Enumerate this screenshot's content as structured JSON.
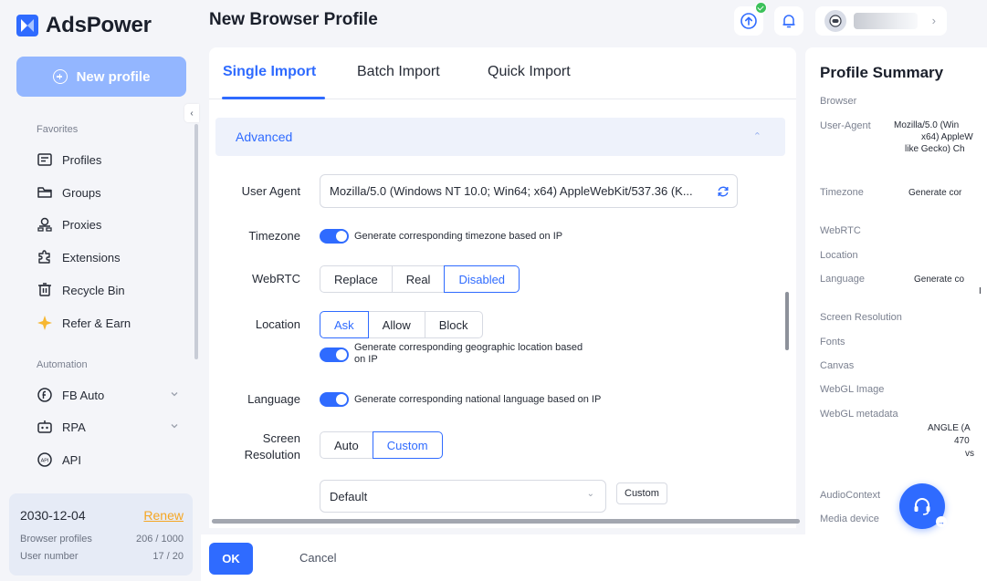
{
  "brand": {
    "name": "AdsPower",
    "accent": "#2f6bff"
  },
  "sidebar": {
    "new_profile_label": "New profile",
    "favorites_label": "Favorites",
    "items": [
      {
        "label": "Profiles",
        "icon": "profiles-icon"
      },
      {
        "label": "Groups",
        "icon": "folder-icon"
      },
      {
        "label": "Proxies",
        "icon": "proxies-icon"
      },
      {
        "label": "Extensions",
        "icon": "puzzle-icon"
      },
      {
        "label": "Recycle Bin",
        "icon": "trash-icon"
      },
      {
        "label": "Refer & Earn",
        "icon": "star-icon"
      }
    ],
    "automation_label": "Automation",
    "automation_items": [
      {
        "label": "FB Auto",
        "icon": "fb-auto-icon"
      },
      {
        "label": "RPA",
        "icon": "robot-icon"
      },
      {
        "label": "API",
        "icon": "api-icon"
      }
    ]
  },
  "account": {
    "expiry": "2030-12-04",
    "renew_label": "Renew",
    "profiles_label": "Browser profiles",
    "profiles_value": "206 / 1000",
    "users_label": "User number",
    "users_value": "17 / 20"
  },
  "header": {
    "title": "New Browser Profile"
  },
  "tabs": [
    {
      "label": "Single Import",
      "active": true
    },
    {
      "label": "Batch Import",
      "active": false
    },
    {
      "label": "Quick Import",
      "active": false
    }
  ],
  "advanced": {
    "title": "Advanced",
    "user_agent_label": "User Agent",
    "user_agent_value": "Mozilla/5.0 (Windows NT 10.0; Win64; x64) AppleWebKit/537.36 (K...",
    "timezone_label": "Timezone",
    "timezone_toggle_text": "Generate corresponding timezone based on IP",
    "webrtc_label": "WebRTC",
    "webrtc_options": [
      "Replace",
      "Real",
      "Disabled"
    ],
    "webrtc_selected": "Disabled",
    "location_label": "Location",
    "location_options": [
      "Ask",
      "Allow",
      "Block"
    ],
    "location_selected": "Ask",
    "location_toggle_line1": "Generate corresponding geographic location based",
    "location_toggle_line2": "on IP",
    "language_label": "Language",
    "language_toggle_text": "Generate corresponding national language based on IP",
    "screen_label_line1": "Screen",
    "screen_label_line2": "Resolution",
    "screen_options": [
      "Auto",
      "Custom"
    ],
    "screen_selected": "Custom",
    "resolution_select": "Default",
    "resolution_custom_btn": "Custom"
  },
  "footer": {
    "ok_label": "OK",
    "cancel_label": "Cancel"
  },
  "summary": {
    "title": "Profile Summary",
    "browser_label": "Browser",
    "user_agent_label": "User-Agent",
    "user_agent_lines": [
      "Mozilla/5.0 (Win",
      "x64) AppleW",
      "like Gecko) Ch"
    ],
    "timezone_label": "Timezone",
    "timezone_value": "Generate cor",
    "webrtc_label": "WebRTC",
    "location_label": "Location",
    "language_label": "Language",
    "language_lines": [
      "Generate co",
      "I"
    ],
    "screen_label": "Screen Resolution",
    "fonts_label": "Fonts",
    "canvas_label": "Canvas",
    "webgl_image_label": "WebGL Image",
    "webgl_metadata_label": "WebGL metadata",
    "webgl_metadata_lines": [
      "ANGLE (A",
      "470",
      "vs"
    ],
    "audio_label": "AudioContext",
    "media_label": "Media device"
  }
}
